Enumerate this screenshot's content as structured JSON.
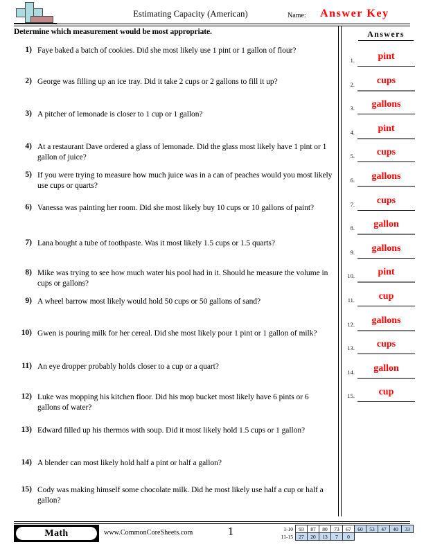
{
  "header": {
    "logo_name": "commoncoresheets-logo",
    "title": "Estimating Capacity (American)",
    "name_label": "Name:",
    "name_value": "Answer Key",
    "instructions": "Determine which measurement would be most appropriate."
  },
  "questions": [
    {
      "number": "1)",
      "text": "Faye baked a batch of cookies. Did she most likely use 1 pint or 1 gallon of flour?"
    },
    {
      "number": "2)",
      "text": "George was filling up an ice tray. Did it take 2 cups or 2 gallons to fill it up?"
    },
    {
      "number": "3)",
      "text": "A pitcher of lemonade is closer to 1 cup or 1 gallon?"
    },
    {
      "number": "4)",
      "text": "At a restaurant Dave ordered a glass of lemonade. Did the glass most likely have 1 pint or 1 gallon of juice?"
    },
    {
      "number": "5)",
      "text": "If you were trying to measure how much juice was in a can of peaches would you most likely use cups or quarts?"
    },
    {
      "number": "6)",
      "text": "Vanessa was painting her room. Did she most likely buy 10 cups or 10 gallons of paint?"
    },
    {
      "number": "7)",
      "text": "Lana bought a tube of toothpaste. Was it most likely 1.5 cups or 1.5 quarts?"
    },
    {
      "number": "8)",
      "text": "Mike was trying to see how much water his pool had in it. Should he measure the volume in cups or gallons?"
    },
    {
      "number": "9)",
      "text": "A wheel barrow most likely would hold 50 cups or 50 gallons of sand?"
    },
    {
      "number": "10)",
      "text": "Gwen is pouring milk for her cereal. Did she most likely pour 1 pint or 1 gallon of milk?"
    },
    {
      "number": "11)",
      "text": "An eye dropper probably holds closer to a cup or a quart?"
    },
    {
      "number": "12)",
      "text": "Luke was mopping his kitchen floor. Did his mop bucket most likely have 6 pints or 6 gallons of water?"
    },
    {
      "number": "13)",
      "text": "Edward filled up his thermos with soup. Did it most likely hold 1.5 cups or 1 gallon?"
    },
    {
      "number": "14)",
      "text": "A blender can most likely hold half a pint or half a gallon?"
    },
    {
      "number": "15)",
      "text": "Cody was making himself some chocolate milk. Did he most likely use half a cup or half a gallon?"
    }
  ],
  "answers": {
    "heading": "Answers",
    "color": "#ff0000",
    "items": [
      {
        "index": "1.",
        "value": "pint"
      },
      {
        "index": "2.",
        "value": "cups"
      },
      {
        "index": "3.",
        "value": "gallons"
      },
      {
        "index": "4.",
        "value": "pint"
      },
      {
        "index": "5.",
        "value": "cups"
      },
      {
        "index": "6.",
        "value": "gallons"
      },
      {
        "index": "7.",
        "value": "cups"
      },
      {
        "index": "8.",
        "value": "gallon"
      },
      {
        "index": "9.",
        "value": "gallons"
      },
      {
        "index": "10.",
        "value": "pint"
      },
      {
        "index": "11.",
        "value": "cup"
      },
      {
        "index": "12.",
        "value": "gallons"
      },
      {
        "index": "13.",
        "value": "cups"
      },
      {
        "index": "14.",
        "value": "gallon"
      },
      {
        "index": "15.",
        "value": "cup"
      }
    ]
  },
  "footer": {
    "subject_badge": "Math",
    "site_url": "www.CommonCoreSheets.com",
    "page_number": "1"
  },
  "grade_table": {
    "rows": [
      {
        "label": "1-10",
        "cells": [
          {
            "value": "93",
            "shaded": false
          },
          {
            "value": "87",
            "shaded": false
          },
          {
            "value": "80",
            "shaded": false
          },
          {
            "value": "73",
            "shaded": false
          },
          {
            "value": "67",
            "shaded": false
          },
          {
            "value": "60",
            "shaded": true
          },
          {
            "value": "53",
            "shaded": true
          },
          {
            "value": "47",
            "shaded": true
          },
          {
            "value": "40",
            "shaded": true
          },
          {
            "value": "33",
            "shaded": true
          }
        ]
      },
      {
        "label": "11-15",
        "cells": [
          {
            "value": "27",
            "shaded": true
          },
          {
            "value": "20",
            "shaded": true
          },
          {
            "value": "13",
            "shaded": true
          },
          {
            "value": "7",
            "shaded": true
          },
          {
            "value": "0",
            "shaded": true
          }
        ]
      }
    ],
    "shade_color": "#c5d9f1"
  }
}
